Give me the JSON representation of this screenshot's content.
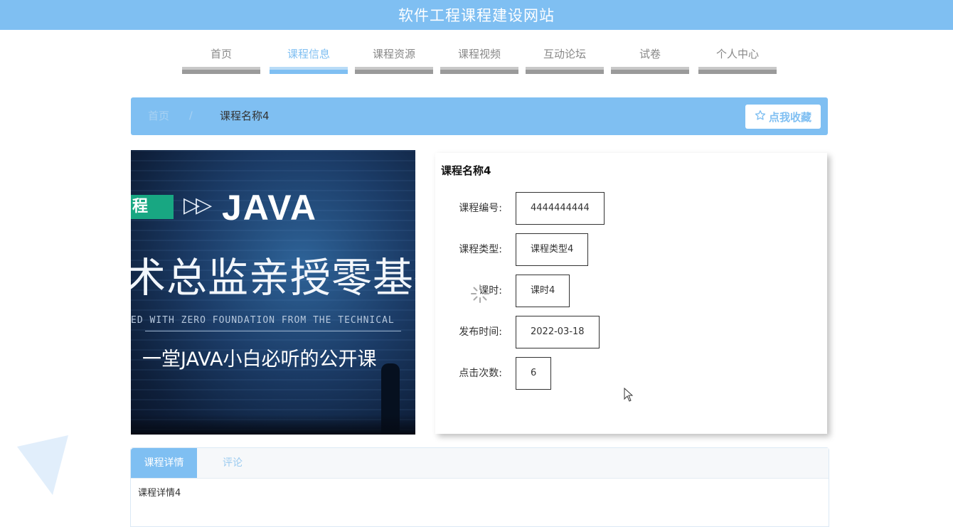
{
  "header": {
    "site_title": "软件工程课程建设网站"
  },
  "nav": {
    "items": [
      {
        "label": "首页",
        "active": false
      },
      {
        "label": "课程信息",
        "active": true
      },
      {
        "label": "课程资源",
        "active": false
      },
      {
        "label": "课程视频",
        "active": false
      },
      {
        "label": "互动论坛",
        "active": false
      },
      {
        "label": "试卷",
        "active": false
      },
      {
        "label": "个人中心",
        "active": false
      }
    ]
  },
  "breadcrumb": {
    "home": "首页",
    "separator": "/",
    "current": "课程名称4"
  },
  "favorite_button": {
    "icon": "star-outline-icon",
    "label": "点我收藏"
  },
  "course_image": {
    "tag": "程",
    "title": "JAVA",
    "headline": "术总监亲授零基础入",
    "english": "ED WITH ZERO FOUNDATION FROM THE TECHNICAL",
    "subline": "一堂JAVA小白必听的公开课"
  },
  "course_info": {
    "name": "课程名称4",
    "fields": [
      {
        "label": "课程编号:",
        "value": "4444444444"
      },
      {
        "label": "课程类型:",
        "value": "课程类型4"
      },
      {
        "label": "课时:",
        "value": "课时4"
      },
      {
        "label": "发布时间:",
        "value": "2022-03-18"
      },
      {
        "label": "点击次数:",
        "value": "6"
      }
    ]
  },
  "tabs": {
    "items": [
      {
        "label": "课程详情",
        "active": true
      },
      {
        "label": "评论",
        "active": false
      }
    ],
    "content": "课程详情4"
  },
  "colors": {
    "primary": "#7fbff2",
    "nav_bar": "#9a9a9a",
    "text": "#333333"
  }
}
